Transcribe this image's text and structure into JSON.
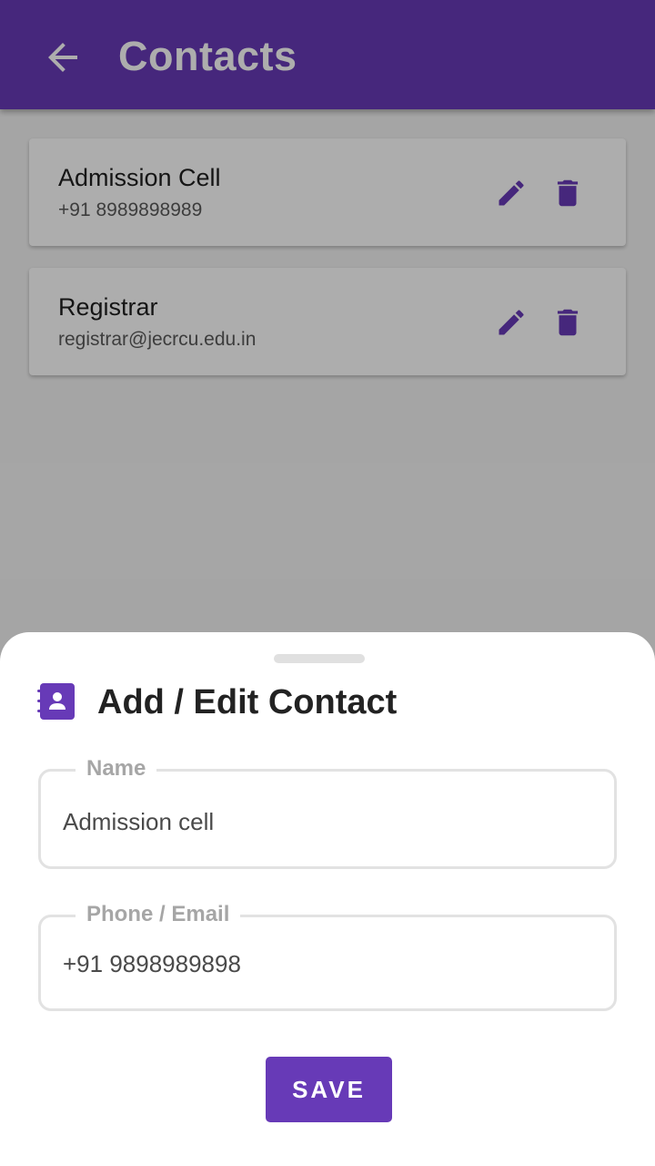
{
  "app_bar": {
    "title": "Contacts",
    "back_icon": "arrow-left-icon",
    "color": "#673ab7"
  },
  "contacts": [
    {
      "name": "Admission Cell",
      "detail": "+91 8989898989",
      "edit_icon": "pencil-icon",
      "delete_icon": "trash-icon"
    },
    {
      "name": "Registrar",
      "detail": "registrar@jecrcu.edu.in",
      "edit_icon": "pencil-icon",
      "delete_icon": "trash-icon"
    }
  ],
  "sheet": {
    "icon": "contact-book-icon",
    "title": "Add / Edit Contact",
    "name_field": {
      "label": "Name",
      "value": "Admission cell"
    },
    "contact_field": {
      "label": "Phone / Email",
      "value": "+91 9898989898"
    },
    "save_label": "SAVE"
  },
  "colors": {
    "accent": "#673ab7",
    "scrim": "rgba(0,0,0,0.32)"
  }
}
